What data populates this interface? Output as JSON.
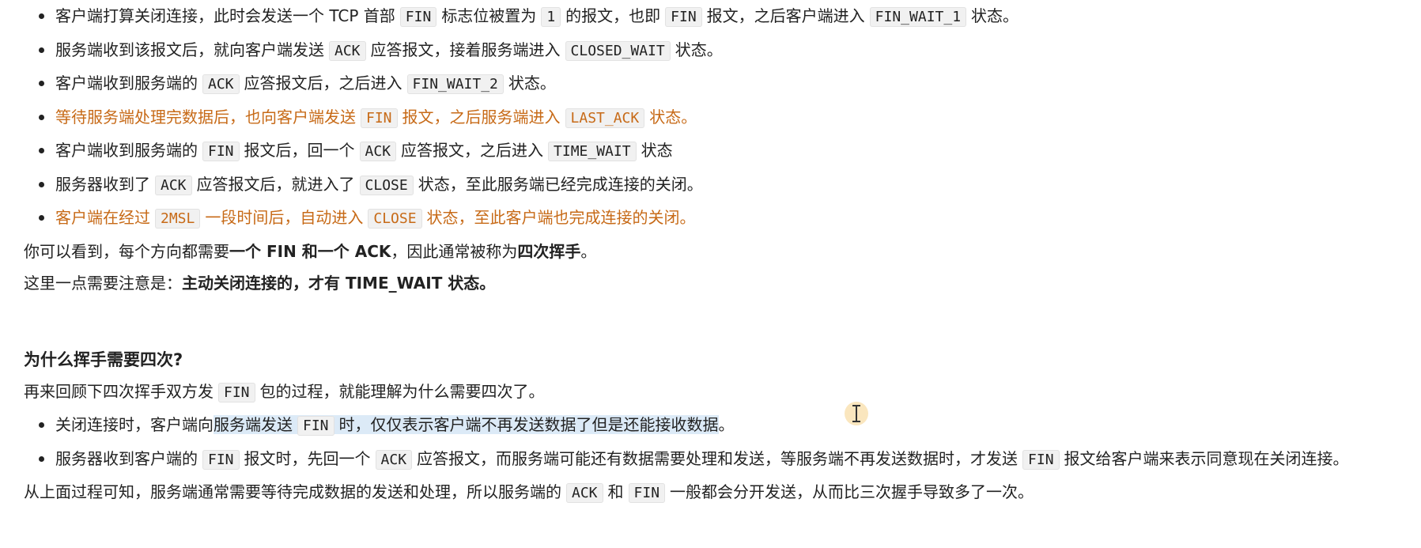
{
  "steps": [
    {
      "t1": "客户端打算关闭连接，此时会发送一个 TCP 首部",
      "c1": "FIN",
      "t2": "标志位被置为",
      "c2": "1",
      "t3": "的报文，也即",
      "c3": "FIN",
      "t4": "报文，之后客户端进入",
      "c4": "FIN_WAIT_1",
      "t5": "状态。"
    },
    {
      "t1": "服务端收到该报文后，就向客户端发送",
      "c1": "ACK",
      "t2": "应答报文，接着服务端进入",
      "c2": "CLOSED_WAIT",
      "t3": "状态。"
    },
    {
      "t1": "客户端收到服务端的",
      "c1": "ACK",
      "t2": "应答报文后，之后进入",
      "c2": "FIN_WAIT_2",
      "t3": "状态。"
    },
    {
      "t1": "等待服务端处理完数据后，也向客户端发送",
      "c1": "FIN",
      "t2": "报文，之后服务端进入",
      "c2": "LAST_ACK",
      "t3": "状态。"
    },
    {
      "t1": "客户端收到服务端的",
      "c1": "FIN",
      "t2": "报文后，回一个",
      "c2": "ACK",
      "t3": "应答报文，之后进入",
      "c3": "TIME_WAIT",
      "t4": "状态"
    },
    {
      "t1": "服务器收到了",
      "c1": "ACK",
      "t2": "应答报文后，就进入了",
      "c2": "CLOSE",
      "t3": "状态，至此服务端已经完成连接的关闭。"
    },
    {
      "t1": "客户端在经过",
      "c1": "2MSL",
      "t2": "一段时间后，自动进入",
      "c2": "CLOSE",
      "t3": "状态，至此客户端也完成连接的关闭。"
    }
  ],
  "summary1": {
    "t1": "你可以看到，每个方向都需要",
    "b1": "一个 FIN 和一个 ACK",
    "t2": "，因此通常被称为",
    "b2": "四次挥手",
    "t3": "。"
  },
  "summary2": {
    "t1": "这里一点需要注意是：",
    "b1": "主动关闭连接的，才有 TIME_WAIT 状态。"
  },
  "section": {
    "heading": "为什么挥手需要四次?",
    "intro": {
      "t1": "再来回顾下四次挥手双方发",
      "c1": "FIN",
      "t2": "包的过程，就能理解为什么需要四次了。"
    },
    "bullets": [
      {
        "t1": "关闭连接时，客户端向",
        "h1": "服务端发送",
        "c1": "FIN",
        "h2": "时，仅仅表示客户端不再发送数据了但是还能接收数据",
        "t2": "。"
      },
      {
        "t1": "服务器收到客户端的",
        "c1": "FIN",
        "t2": "报文时，先回一个",
        "c2": "ACK",
        "t3": "应答报文，而服务端可能还有数据需要处理和发送，等服务端不再发送数据时，才发送",
        "c3": "FIN",
        "t4": "报文给客户端来表示同意现在关闭连接。"
      }
    ],
    "conclusion": {
      "t1": "从上面过程可知，服务端通常需要等待完成数据的发送和处理，所以服务端的",
      "c1": "ACK",
      "t2": "和",
      "c2": "FIN",
      "t3": "一般都会分开发送，从而比三次握手导致多了一次。"
    }
  },
  "colors": {
    "accent_orange": "#c76a17",
    "selection": "#dceaf7",
    "code_bg": "#f1f1f1"
  },
  "icons": {
    "cursor": "text-cursor-icon"
  }
}
